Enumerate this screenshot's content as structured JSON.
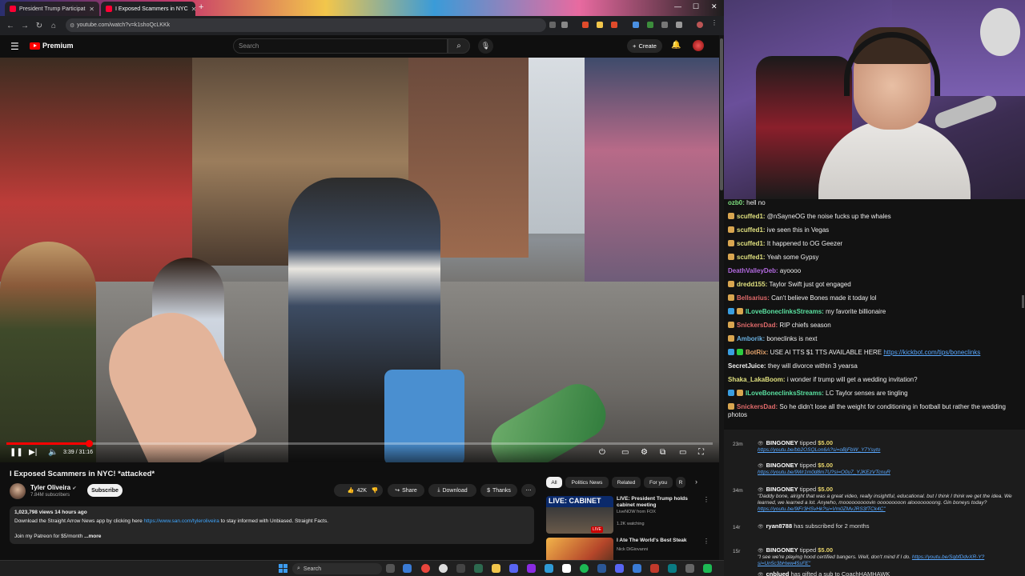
{
  "browser": {
    "tabs": [
      {
        "label": "President Trump Participat",
        "active": false
      },
      {
        "label": "I Exposed Scammers in NYC",
        "active": true
      }
    ],
    "new_tab_icon": "+",
    "url": "youtube.com/watch?v=k1shoQcLKKk"
  },
  "youtube": {
    "logo_text": "Premium",
    "search_placeholder": "Search",
    "create_label": "Create",
    "video": {
      "time": "3:39 / 31:16",
      "progress": 0.117
    },
    "title": "I Exposed Scammers in NYC! *attacked*",
    "channel": {
      "name": "Tyler Oliveira",
      "subscribers": "7.84M subscribers",
      "subscribe_label": "Subscribe"
    },
    "actions": {
      "likes": "42K",
      "share": "Share",
      "download": "Download",
      "thanks": "Thanks"
    },
    "description": {
      "meta": "1,023,798 views  14 hours ago",
      "line_prefix": "Download the Straight Arrow News app by clicking here ",
      "line_link": "https://www.san.com/tyleroliveira",
      "line_suffix": " to stay informed with Unbiased. Straight Facts.",
      "line3": "Join my Patreon for $5/month",
      "more": "...more"
    },
    "chips": [
      "All",
      "Politics News",
      "Related",
      "For you",
      "R"
    ],
    "recommendations": [
      {
        "thumb_label": "LIVE: CABINET",
        "title": "LIVE: President Trump holds cabinet meeting",
        "channel": "LiveNOW from FOX",
        "meta": "1.2K watching",
        "live": "LIVE"
      },
      {
        "thumb_label": "",
        "title": "I Ate The World's Best Steak",
        "channel": "Nick DiGiovanni",
        "meta": ""
      }
    ]
  },
  "chat": {
    "messages": [
      {
        "user": "ozb0",
        "color": "#7fe07f",
        "text": "hell no",
        "badges": []
      },
      {
        "user": "scuffed1",
        "color": "#e0e07f",
        "text": "@nSayneOG the noise fucks up the whales",
        "badges": [
          "#d9a650"
        ]
      },
      {
        "user": "scuffed1",
        "color": "#e0e07f",
        "text": "ive seen this in Vegas",
        "badges": [
          "#d9a650"
        ]
      },
      {
        "user": "scuffed1",
        "color": "#e0e07f",
        "text": "It happened to OG Geezer",
        "badges": [
          "#d9a650"
        ]
      },
      {
        "user": "scuffed1",
        "color": "#e0e07f",
        "text": "Yeah some Gypsy",
        "badges": [
          "#d9a650"
        ]
      },
      {
        "user": "DeathValleyDeb",
        "color": "#b36ae0",
        "text": "ayoooo",
        "badges": []
      },
      {
        "user": "dredd155",
        "color": "#e0e07f",
        "text": "Taylor Swift just got engaged",
        "badges": [
          "#d9a650"
        ]
      },
      {
        "user": "Bellsarius",
        "color": "#e06a6a",
        "text": "Can't believe Bones made it today lol",
        "badges": [
          "#d9a650"
        ]
      },
      {
        "user": "ILoveBoneclinksStreams",
        "color": "#5ae0a0",
        "text": "my favorite billionaire",
        "badges": [
          "#3a9ee0",
          "#d9a650"
        ]
      },
      {
        "user": "SnickersDad",
        "color": "#e06a6a",
        "text": "RIP chiefs season",
        "badges": [
          "#d9a650"
        ]
      },
      {
        "user": "Amborik",
        "color": "#6ab0e0",
        "text": "boneclinks is next",
        "badges": [
          "#d9a650"
        ]
      },
      {
        "user": "BotRix",
        "color": "#e0a06a",
        "text": "USE AI TTS $1 TTS AVAILABLE HERE ",
        "link": "https://kickbot.com/tips/boneclinks",
        "badges": [
          "#3a9ee0",
          "#2ecc40"
        ]
      },
      {
        "user": "SecretJuice",
        "color": "#f0f0f0",
        "text": "they will divorce within 3 yearsa",
        "badges": []
      },
      {
        "user": "Shaka_LakaBoom",
        "color": "#e0e07f",
        "text": "i wonder if trump will get a wedding invitation?",
        "badges": []
      },
      {
        "user": "ILoveBoneclinksStreams",
        "color": "#5ae0a0",
        "text": "LC Taylor senses are tingling",
        "badges": [
          "#3a9ee0",
          "#d9a650"
        ]
      },
      {
        "user": "SnickersDad",
        "color": "#e06a6a",
        "text": "So he didn't lose all the weight for conditioning in football but rather the wedding photos",
        "badges": [
          "#d9a650"
        ]
      }
    ]
  },
  "events": [
    {
      "age": "23m",
      "who": "BINGONEY",
      "action": "tipped",
      "amount": "$5.00",
      "body": "",
      "link": "https://youtu.be/bb2OSQLon6A?si=oBjFbW_Y7Ysyto"
    },
    {
      "age": "",
      "who": "BINGONEY",
      "action": "tipped",
      "amount": "$5.00",
      "body": "",
      "link": "https://youtu.be/9Wr1m0d8m7U?si=O0u7_YJKEzVTcnuR"
    },
    {
      "age": "34m",
      "who": "BINGONEY",
      "action": "tipped",
      "amount": "$5.00",
      "body": "\"Daddy bone, alright that was a great video, really insightful, educational. but I think I think we get the idea. We learned, we learned a lot. Anywho, mooooooooovin ooooooooon aloooooooong. Gin boneys today? ",
      "link": "https://youtu.be/9lFr3HSvHk?si=Vm0ZMvJRS3fTCk4C\""
    },
    {
      "age": "14r",
      "who": "ryan8788",
      "action": "has subscribed for 2 months",
      "amount": "",
      "body": "",
      "link": ""
    },
    {
      "age": "15r",
      "who": "BINGONEY",
      "action": "tipped",
      "amount": "$5.00",
      "body": "\"I see we're playing hood certified bangers. Well, don't mind if I do. ",
      "link": "https://youtu.be/SqbfDdvXR-Y?si=Un5c3bHww45sFE\""
    },
    {
      "age": "",
      "who": "cnblued",
      "action": "has gifted a sub to CoachHAMHAWK",
      "amount": "",
      "body": "",
      "link": ""
    }
  ],
  "taskbar": {
    "search_label": "Search"
  }
}
